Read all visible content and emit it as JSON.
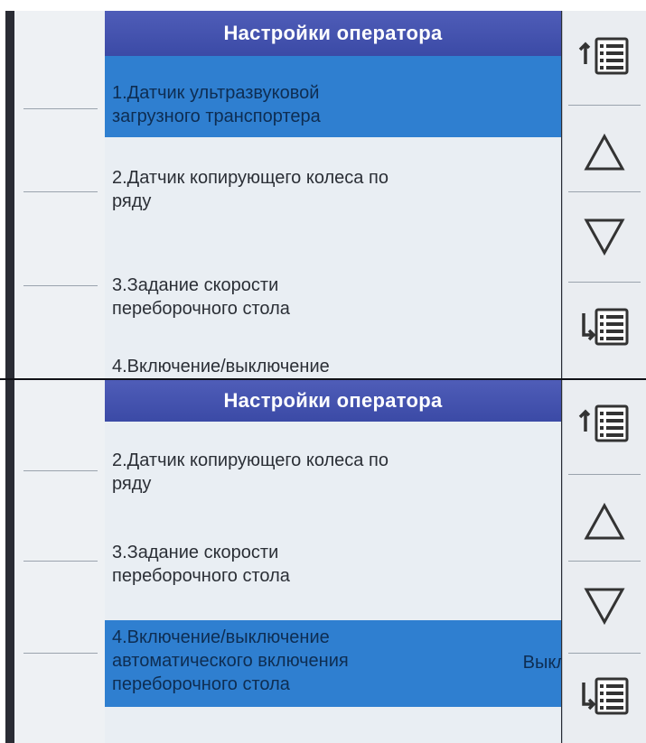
{
  "screens": [
    {
      "header": {
        "title": "Настройки оператора"
      },
      "items": [
        {
          "lines": [
            "1.Датчик ультразвуковой",
            "загрузного транспортера"
          ],
          "selected": true
        },
        {
          "lines": [
            "2.Датчик копирующего колеса по",
            "ряду"
          ],
          "selected": false
        },
        {
          "lines": [
            "3.Задание скорости",
            "переборочного стола"
          ],
          "selected": false
        },
        {
          "lines": [
            "4.Включение/выключение"
          ],
          "selected": false
        }
      ]
    },
    {
      "header": {
        "title": "Настройки оператора"
      },
      "items": [
        {
          "lines": [
            "2.Датчик копирующего колеса по",
            "ряду"
          ],
          "selected": false
        },
        {
          "lines": [
            "3.Задание скорости",
            "переборочного стола"
          ],
          "selected": false
        },
        {
          "lines": [
            "4.Включение/выключение",
            "автоматического включения",
            "переборочного стола"
          ],
          "value": "Выкл",
          "selected": true
        }
      ]
    }
  ],
  "icons": {
    "first_page": "list-first-icon",
    "up": "triangle-up-icon",
    "down": "triangle-down-icon",
    "last_page": "list-last-icon"
  },
  "colors": {
    "header": "#3f4ea9",
    "selected_row": "#2f7fd0",
    "panel": "#e9eef3"
  }
}
